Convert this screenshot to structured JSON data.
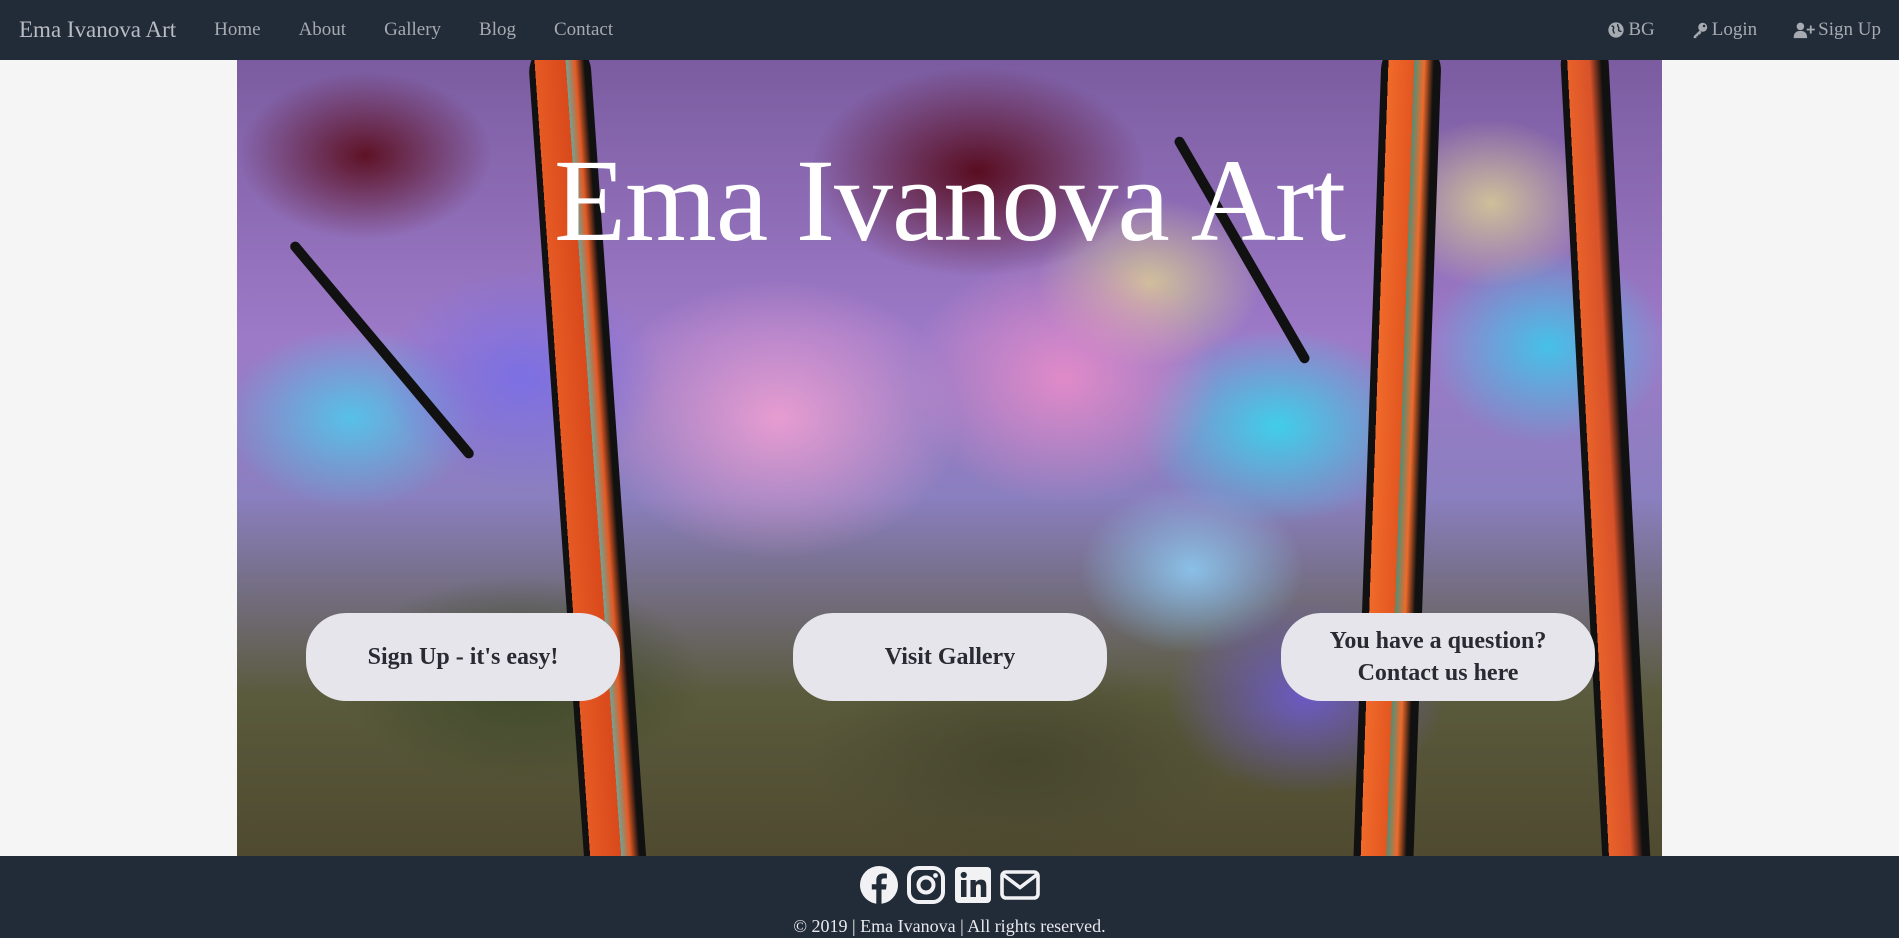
{
  "navbar": {
    "brand": "Ema Ivanova Art",
    "links": [
      "Home",
      "About",
      "Gallery",
      "Blog",
      "Contact"
    ],
    "right": {
      "language": {
        "label": "BG",
        "icon": "globe-icon"
      },
      "login": {
        "label": "Login",
        "icon": "key-icon"
      },
      "signup": {
        "label": "Sign Up",
        "icon": "user-plus-icon"
      }
    }
  },
  "hero": {
    "title": "Ema Ivanova Art",
    "buttons": [
      {
        "label": "Sign Up - it's easy!"
      },
      {
        "label": "Visit Gallery"
      },
      {
        "label": "You have a question?\nContact us here"
      }
    ]
  },
  "footer": {
    "social_icons": [
      "facebook-icon",
      "instagram-icon",
      "linkedin-icon",
      "envelope-icon"
    ],
    "copyright": "© 2019 | Ema Ivanova | All rights reserved."
  },
  "colors": {
    "navbar_bg": "#222b38",
    "page_bg": "#f5f5f5",
    "button_bg": "#e6e5eb",
    "button_text": "#2a2a33",
    "nav_text": "#a6aab1",
    "title_text": "#ffffff"
  }
}
